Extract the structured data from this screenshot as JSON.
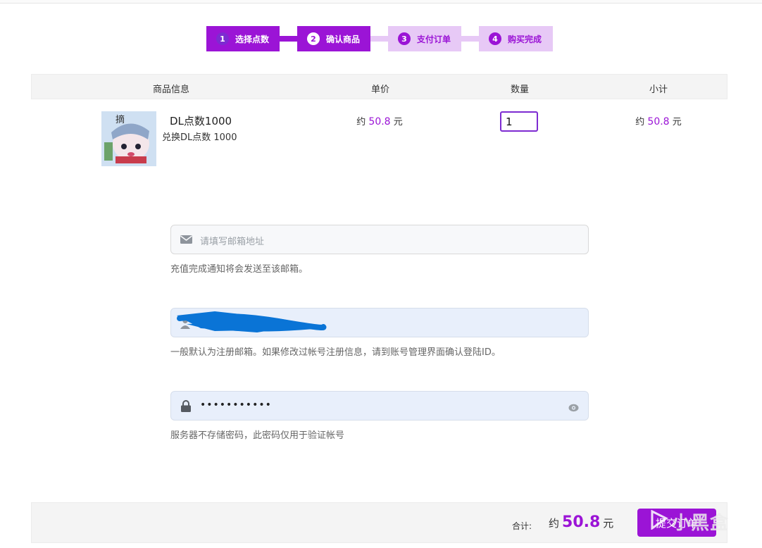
{
  "steps": [
    {
      "num": "1",
      "label": "选择点数"
    },
    {
      "num": "2",
      "label": "确认商品"
    },
    {
      "num": "3",
      "label": "支付订单"
    },
    {
      "num": "4",
      "label": "购买完成"
    }
  ],
  "table": {
    "headers": [
      "商品信息",
      "单价",
      "数量",
      "小计"
    ]
  },
  "product": {
    "name": "DL点数1000",
    "desc": "兑换DL点数 1000",
    "unit_prefix": "约",
    "unit_price": "50.8",
    "currency": "元",
    "quantity": "1",
    "subtotal": "50.8",
    "thumb_text": "摘"
  },
  "form": {
    "email_placeholder": "请填写邮箱地址",
    "email_hint": "充值完成通知将会发送至该邮箱。",
    "login_hint": "一般默认为注册邮箱。如果修改过帐号注册信息，请到账号管理界面确认登陆ID。",
    "password_mask": "•••••••••••",
    "password_hint": "服务器不存储密码，此密码仅用于验证帐号"
  },
  "footer": {
    "total_label": "合计:",
    "total_prefix": "约",
    "total_value": "50.8",
    "currency": "元",
    "submit_label": "提交订单",
    "watermark": "小黑盒"
  },
  "colors": {
    "accent": "#9b14d6",
    "accent_light": "#e7c9f6",
    "redaction": "#0a74d6"
  }
}
